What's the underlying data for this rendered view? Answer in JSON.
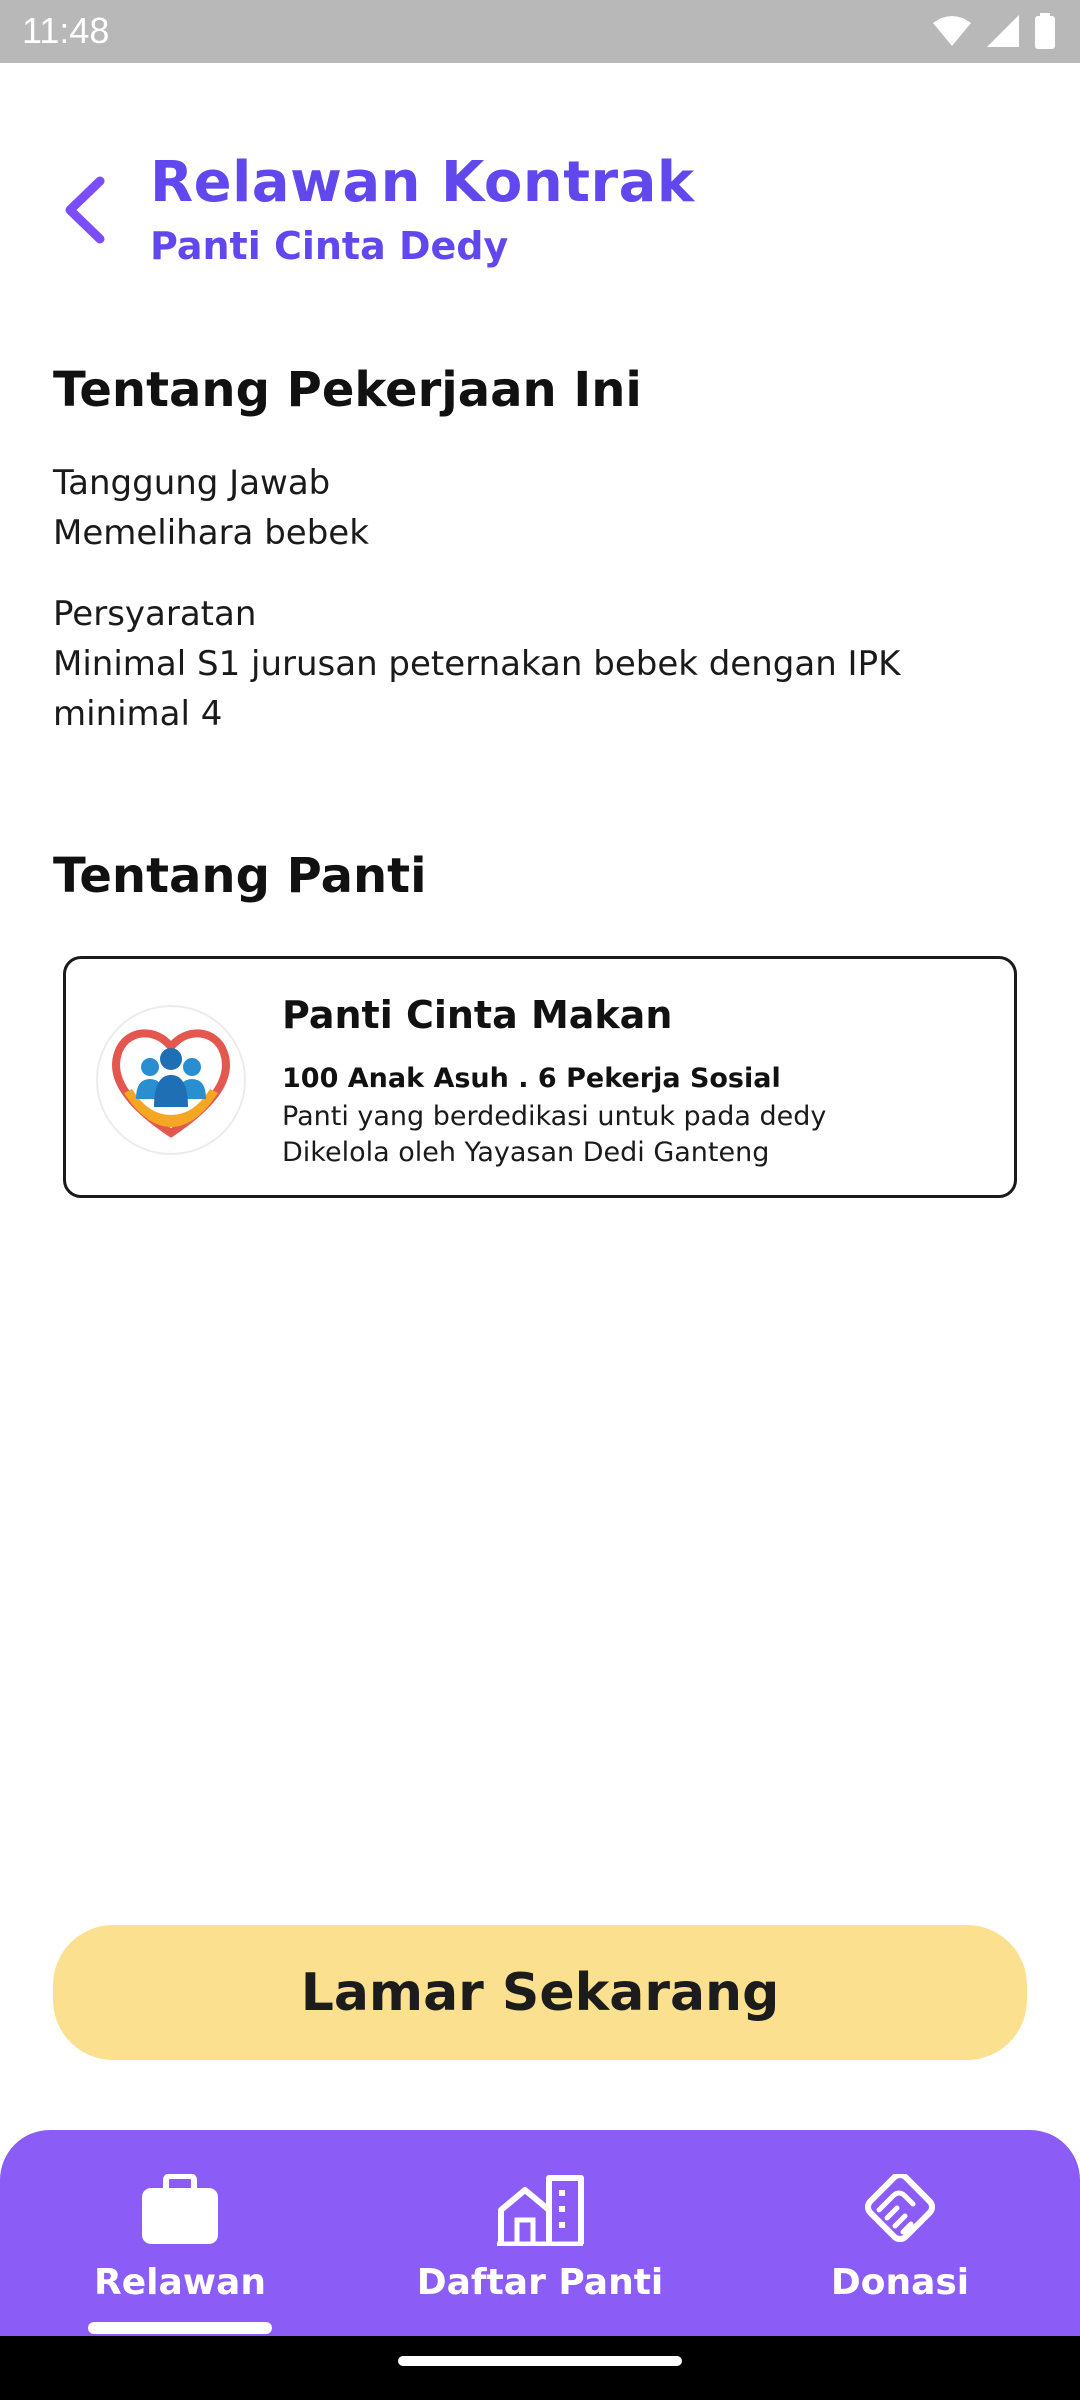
{
  "status_bar": {
    "time": "11:48"
  },
  "header": {
    "title": "Relawan Kontrak",
    "subtitle": "Panti Cinta Dedy"
  },
  "job_section": {
    "title": "Tentang Pekerjaan Ini",
    "responsibility_label": "Tanggung Jawab",
    "responsibility_value": "Memelihara bebek",
    "requirements_label": "Persyaratan",
    "requirements_value": "Minimal S1 jurusan peternakan bebek dengan IPK minimal 4"
  },
  "panti_section": {
    "title": "Tentang Panti",
    "card": {
      "name": "Panti Cinta Makan",
      "stats": "100 Anak Asuh . 6 Pekerja Sosial",
      "description": "Panti yang berdedikasi untuk pada dedy",
      "managed_by": "Dikelola oleh Yayasan Dedi Ganteng"
    }
  },
  "apply_button": {
    "label": "Lamar Sekarang"
  },
  "bottom_nav": {
    "items": [
      {
        "label": "Relawan",
        "icon": "briefcase-icon",
        "active": true
      },
      {
        "label": "Daftar Panti",
        "icon": "building-icon",
        "active": false
      },
      {
        "label": "Donasi",
        "icon": "handshake-icon",
        "active": false
      }
    ]
  },
  "colors": {
    "accent": "#6147ee",
    "nav_background": "#8b5cf6",
    "button_background": "#fbe18f",
    "status_bar": "#b8b8b8"
  }
}
